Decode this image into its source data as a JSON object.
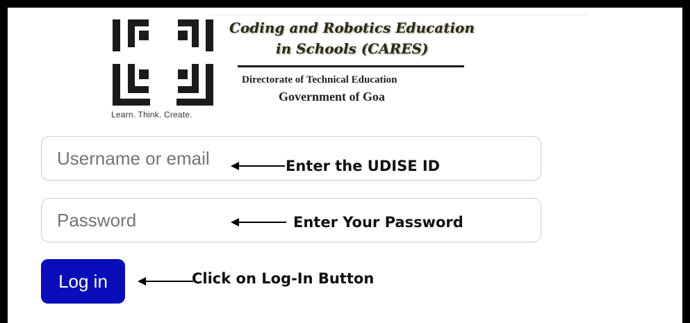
{
  "header": {
    "tagline": "Learn. Think. Create.",
    "brand_line1": "Coding and Robotics Education",
    "brand_line2": "in Schools (CARES)",
    "org_line1": "Directorate of Technical Education",
    "org_line2": "Government of Goa"
  },
  "form": {
    "username_placeholder": "Username or email",
    "password_placeholder": "Password",
    "login_label": "Log in"
  },
  "annotations": {
    "username_note": "Enter the UDISE ID",
    "password_note": "Enter Your Password",
    "login_note": "Click on Log-In Button"
  },
  "colors": {
    "login_button": "#0a0dba",
    "frame": "#000000"
  }
}
